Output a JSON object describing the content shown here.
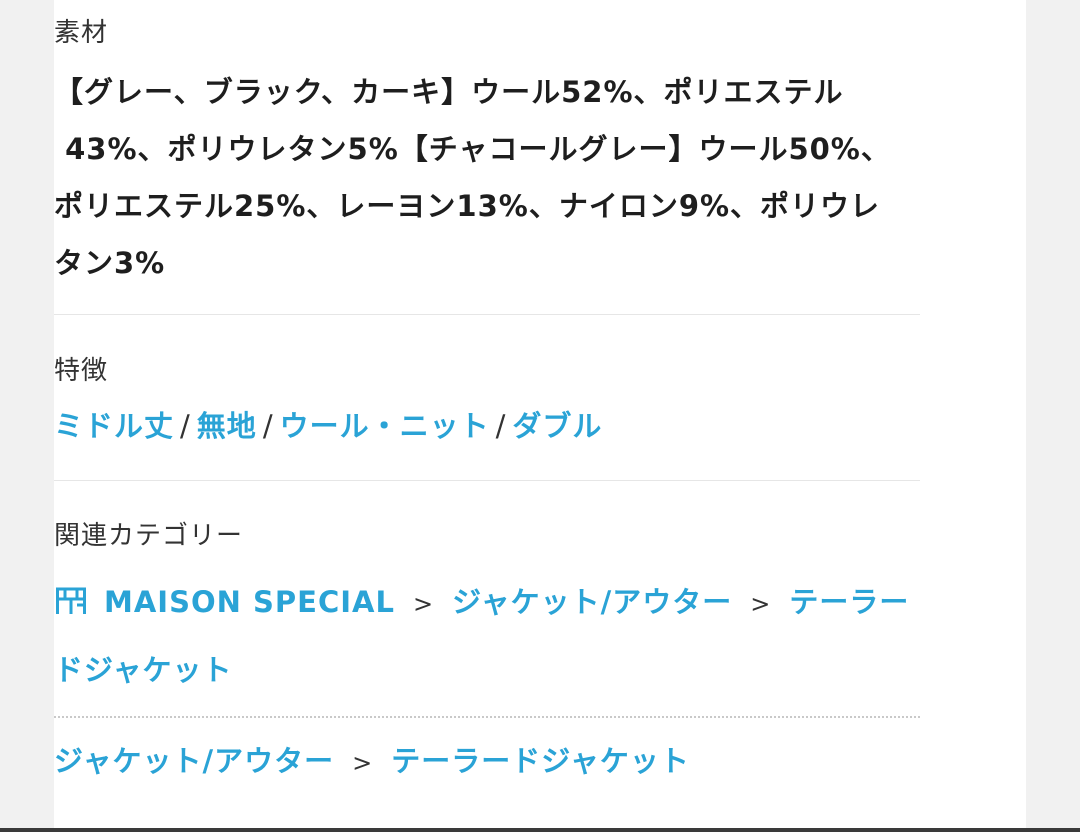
{
  "material": {
    "label": "素材",
    "lines": [
      "【グレー、ブラック、カーキ】ウール52%、ポリエステル",
      " 43%、ポリウレタン5%【チャコールグレー】ウール50%、",
      "ポリエステル25%、レーヨン13%、ナイロン9%、ポリウレ",
      "タン3%"
    ]
  },
  "features": {
    "label": "特徴",
    "separator": "/",
    "items": [
      "ミドル丈",
      "無地",
      "ウール・ニット",
      "ダブル"
    ]
  },
  "related": {
    "label": "関連カテゴリー",
    "separator": ">",
    "brand": {
      "icon": "shop-icon",
      "name": "MAISON SPECIAL"
    },
    "brand_path": [
      "ジャケット/アウター",
      "テーラー",
      "ドジャケット"
    ],
    "general_path": [
      "ジャケット/アウター",
      "テーラードジャケット"
    ]
  },
  "colors": {
    "link": "#2aa3d6",
    "text": "#1e1e1e"
  }
}
